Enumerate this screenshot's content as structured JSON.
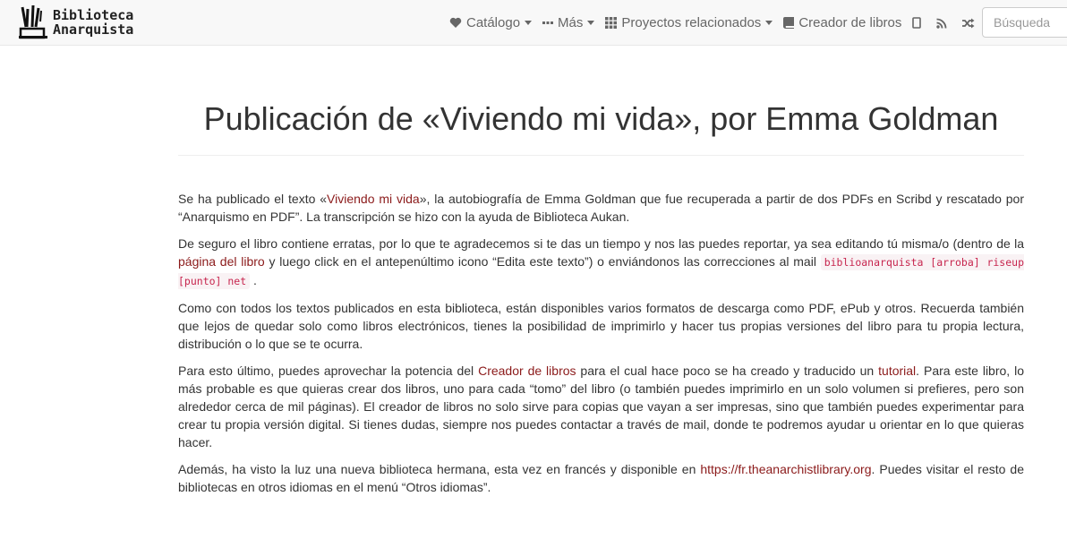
{
  "brand": {
    "line1": "Biblioteca",
    "line2": "Anarquista"
  },
  "nav": {
    "catalog": "Catálogo",
    "more": "Más",
    "projects": "Proyectos relacionados",
    "book_builder": "Creador de libros"
  },
  "icons": [
    "heart-icon",
    "ellipsis-icon",
    "grid-icon",
    "book-icon",
    "tablet-icon",
    "rss-icon",
    "shuffle-icon",
    "plus-icon"
  ],
  "search": {
    "placeholder": "Búsqueda"
  },
  "colors": {
    "link": "#8b1a1a",
    "code": "#c7254e"
  },
  "article": {
    "title": "Publicación de «Viviendo mi vida», por Emma Goldman",
    "p1": {
      "a": "Se ha publicado el texto «",
      "link": "Viviendo mi vida",
      "b": "», la autobiografía de Emma Goldman que fue recuperada a partir de dos PDFs en Scribd y rescatado por “Anarquismo en PDF”. La transcripción se hizo con la ayuda de Biblioteca Aukan."
    },
    "p2": {
      "a": "De seguro el libro contiene erratas, por lo que te agradecemos si te das un tiempo y nos las puedes reportar, ya sea editando tú misma/o (dentro de la ",
      "link": "página del libro",
      "b": " y luego click en el antepenúltimo icono “Edita este texto”) o enviándonos las correcciones al mail ",
      "code": "biblioanarquista [arroba] riseup [punto] net",
      "c": " ."
    },
    "p3": "Como con todos los textos publicados en esta biblioteca, están disponibles varios formatos de descarga como PDF, ePub y otros. Recuerda también que lejos de quedar solo como libros electrónicos, tienes la posibilidad de imprimirlo y hacer tus propias versiones del libro para tu propia lectura, distribución o lo que se te ocurra.",
    "p4": {
      "a": "Para esto último, puedes aprovechar la potencia del ",
      "link1": "Creador de libros",
      "b": " para el cual hace poco se ha creado y traducido un ",
      "link2": "tutorial",
      "c": ". Para este libro, lo más probable es que quieras crear dos libros, uno para cada “tomo” del libro (o también puedes imprimirlo en un solo volumen si prefieres, pero son alrededor cerca de mil páginas). El creador de libros no solo sirve para copias que vayan a ser impresas, sino que también puedes experimentar para crear tu propia versión digital. Si tienes dudas, siempre nos puedes contactar a través de mail, donde te podremos ayudar u orientar en lo que quieras hacer."
    },
    "p5": {
      "a": "Además, ha visto la luz una nueva biblioteca hermana, esta vez en francés y disponible en ",
      "link": "https://fr.theanarchistlibrary.org",
      "b": ". Puedes visitar el resto de bibliotecas en otros idiomas en el menú “Otros idiomas”."
    }
  }
}
